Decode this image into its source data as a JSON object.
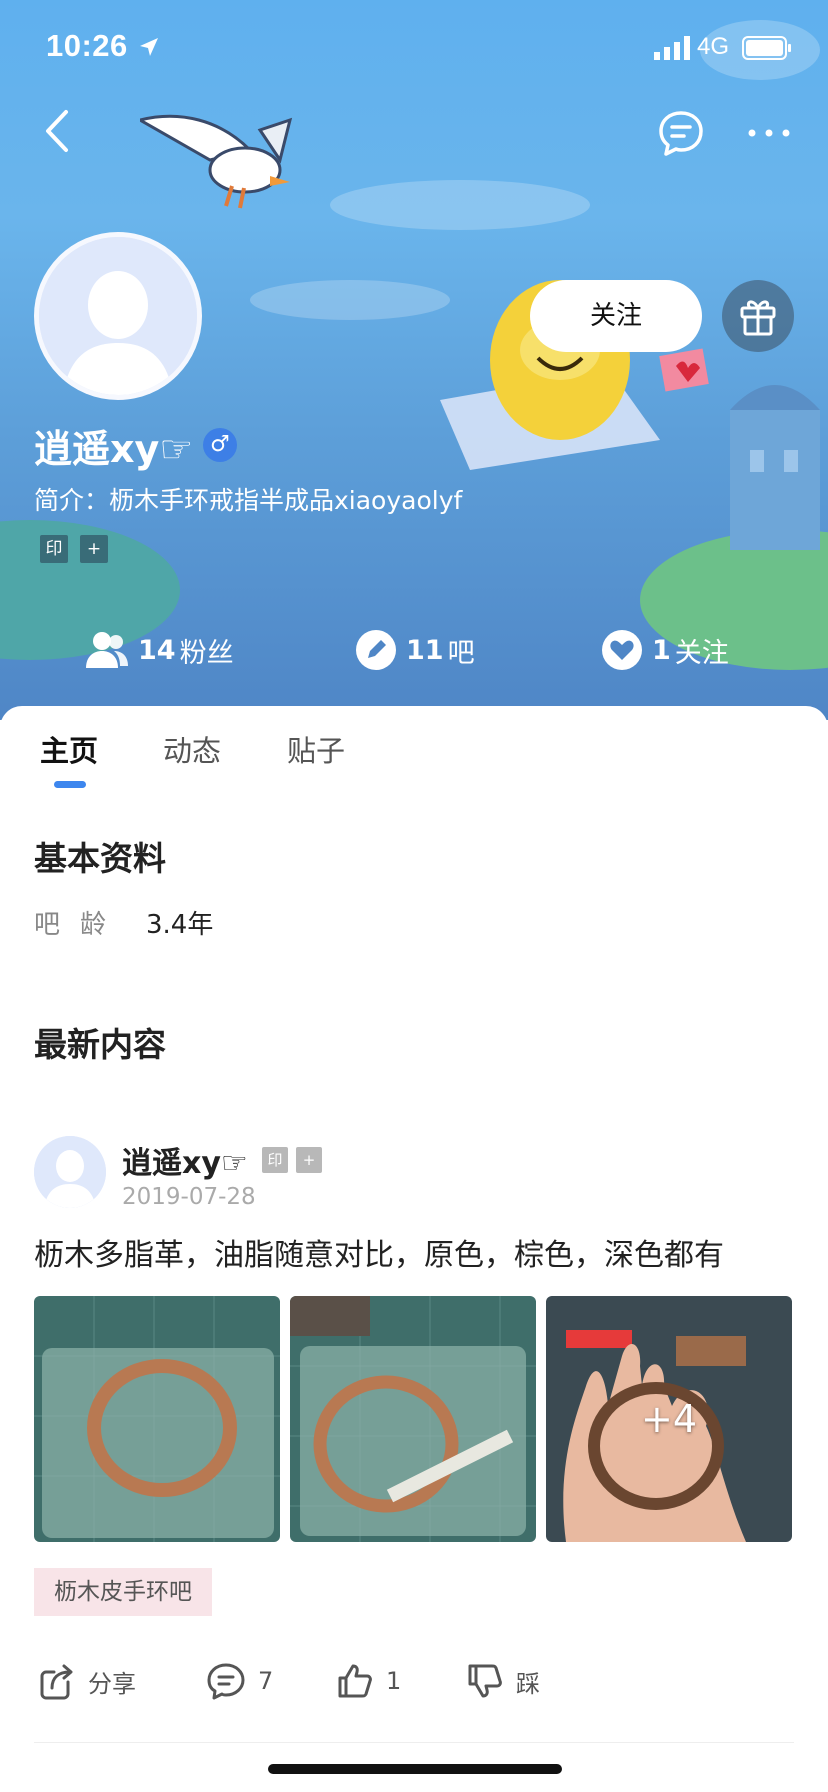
{
  "status_bar": {
    "time": "10:26",
    "network": "4G"
  },
  "header": {
    "follow_label": "关注",
    "username": "逍遥xy☞",
    "gender_symbol": "♂",
    "bio": "简介：枥木手环戒指半成品xiaoyaolyf",
    "badges": [
      "印",
      "+"
    ]
  },
  "stats": [
    {
      "value": "14",
      "label": "粉丝"
    },
    {
      "value": "11",
      "label": "吧"
    },
    {
      "value": "1",
      "label": "关注"
    }
  ],
  "tabs": [
    {
      "label": "主页",
      "active": true
    },
    {
      "label": "动态",
      "active": false
    },
    {
      "label": "贴子",
      "active": false
    }
  ],
  "basic_info": {
    "title": "基本资料",
    "age_label": "吧龄",
    "age_value": "3.4年"
  },
  "latest": {
    "title": "最新内容",
    "post": {
      "username": "逍遥xy☞",
      "badges": [
        "印",
        "+"
      ],
      "date": "2019-07-28",
      "text": "枥木多脂革，油脂随意对比，原色，棕色，深色都有",
      "more_images": "+4",
      "forum_tag": "枥木皮手环吧",
      "actions": {
        "share": "分享",
        "comments": "7",
        "likes": "1",
        "dislike": "踩"
      }
    }
  },
  "colors": {
    "accent": "#3d86ee",
    "banner_top": "#5fb0ee",
    "banner_bottom": "#4f86c6",
    "forum_tag_bg": "#f8e4e8"
  }
}
